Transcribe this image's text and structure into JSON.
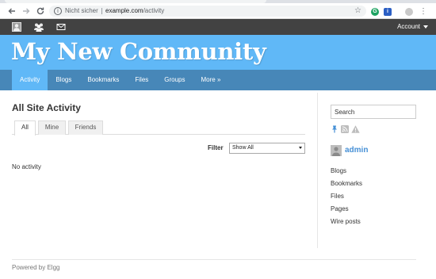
{
  "browser": {
    "security_label": "Nicht sicher",
    "url_host": "example.com",
    "url_path": "/activity",
    "ext_g": "G",
    "ext_b": "i"
  },
  "topbar": {
    "account_label": "Account"
  },
  "site": {
    "title": "My New Community"
  },
  "nav": {
    "items": [
      {
        "label": "Activity"
      },
      {
        "label": "Blogs"
      },
      {
        "label": "Bookmarks"
      },
      {
        "label": "Files"
      },
      {
        "label": "Groups"
      },
      {
        "label": "More »"
      }
    ]
  },
  "main": {
    "title": "All Site Activity",
    "tabs": [
      {
        "label": "All"
      },
      {
        "label": "Mine"
      },
      {
        "label": "Friends"
      }
    ],
    "filter_label": "Filter",
    "filter_value": "Show All",
    "empty_message": "No activity"
  },
  "sidebar": {
    "search_placeholder": "Search",
    "username": "admin",
    "menu": [
      {
        "label": "Blogs"
      },
      {
        "label": "Bookmarks"
      },
      {
        "label": "Files"
      },
      {
        "label": "Pages"
      },
      {
        "label": "Wire posts"
      }
    ]
  },
  "footer": {
    "text": "Powered by Elgg"
  },
  "colors": {
    "topbar": "#424242",
    "header": "#60b8f7",
    "nav": "#4787b8",
    "link": "#4690d6"
  },
  "icons": {
    "browser": [
      "back-arrow-icon",
      "forward-arrow-icon",
      "reload-icon",
      "info-icon",
      "star-icon",
      "menu-kebab-icon"
    ],
    "topbar": [
      "profile-icon",
      "friends-icon",
      "mail-icon",
      "caret-down-icon"
    ],
    "sidebar": [
      "pin-icon",
      "rss-icon",
      "report-warning-icon"
    ]
  }
}
